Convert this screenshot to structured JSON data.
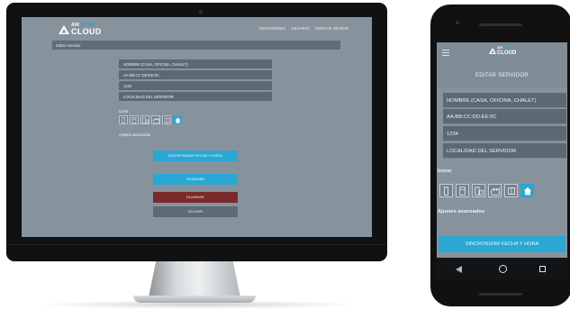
{
  "brand": {
    "line1_a": "AIR",
    "line1_b": "HOME",
    "line2": "CLOUD"
  },
  "desktop": {
    "nav": [
      "SERVIDORES",
      "USUARIO",
      "CERRAR SESIÓN"
    ],
    "page_title": "Editar servidor",
    "fields": [
      {
        "value": "NOMBRE (CASA, OFICINA, CHALET)"
      },
      {
        "value": "AA:BB:CC:DD:EE:0C"
      },
      {
        "value": "1234"
      },
      {
        "value": "LOCALIDAD DEL SERVIDOR"
      }
    ],
    "icon_label": "Icono",
    "advanced_label": "Ajustes avanzados",
    "sync_button": "SINCRONIZAR FECHA Y HORA",
    "save_button": "GUARDAR",
    "delete_button": "ELIMINAR",
    "back_button": "VOLVER"
  },
  "phone": {
    "title": "EDITAR SERVIDOR",
    "fields": [
      {
        "value": "NOMBRE (CASA, OFICINA, CHALET)"
      },
      {
        "value": "AA:BB:CC:DD:EE:0C"
      },
      {
        "value": "1234"
      },
      {
        "value": "LOCALIDAD DEL SERVIDOR"
      }
    ],
    "icon_label": "Icono",
    "advanced_label": "Ajustes avanzados",
    "sync_button": "SINCRONIZAR FECHA Y HORA"
  },
  "icons": [
    {
      "name": "phone-device-icon"
    },
    {
      "name": "fridge-icon"
    },
    {
      "name": "building-icon"
    },
    {
      "name": "factory-icon"
    },
    {
      "name": "outlet-icon"
    },
    {
      "name": "home-icon",
      "selected": true
    }
  ],
  "colors": {
    "accent": "#2aa7d4",
    "danger": "#7a2a2a",
    "screen_bg": "#86939d",
    "field_bg": "#5c6973"
  }
}
